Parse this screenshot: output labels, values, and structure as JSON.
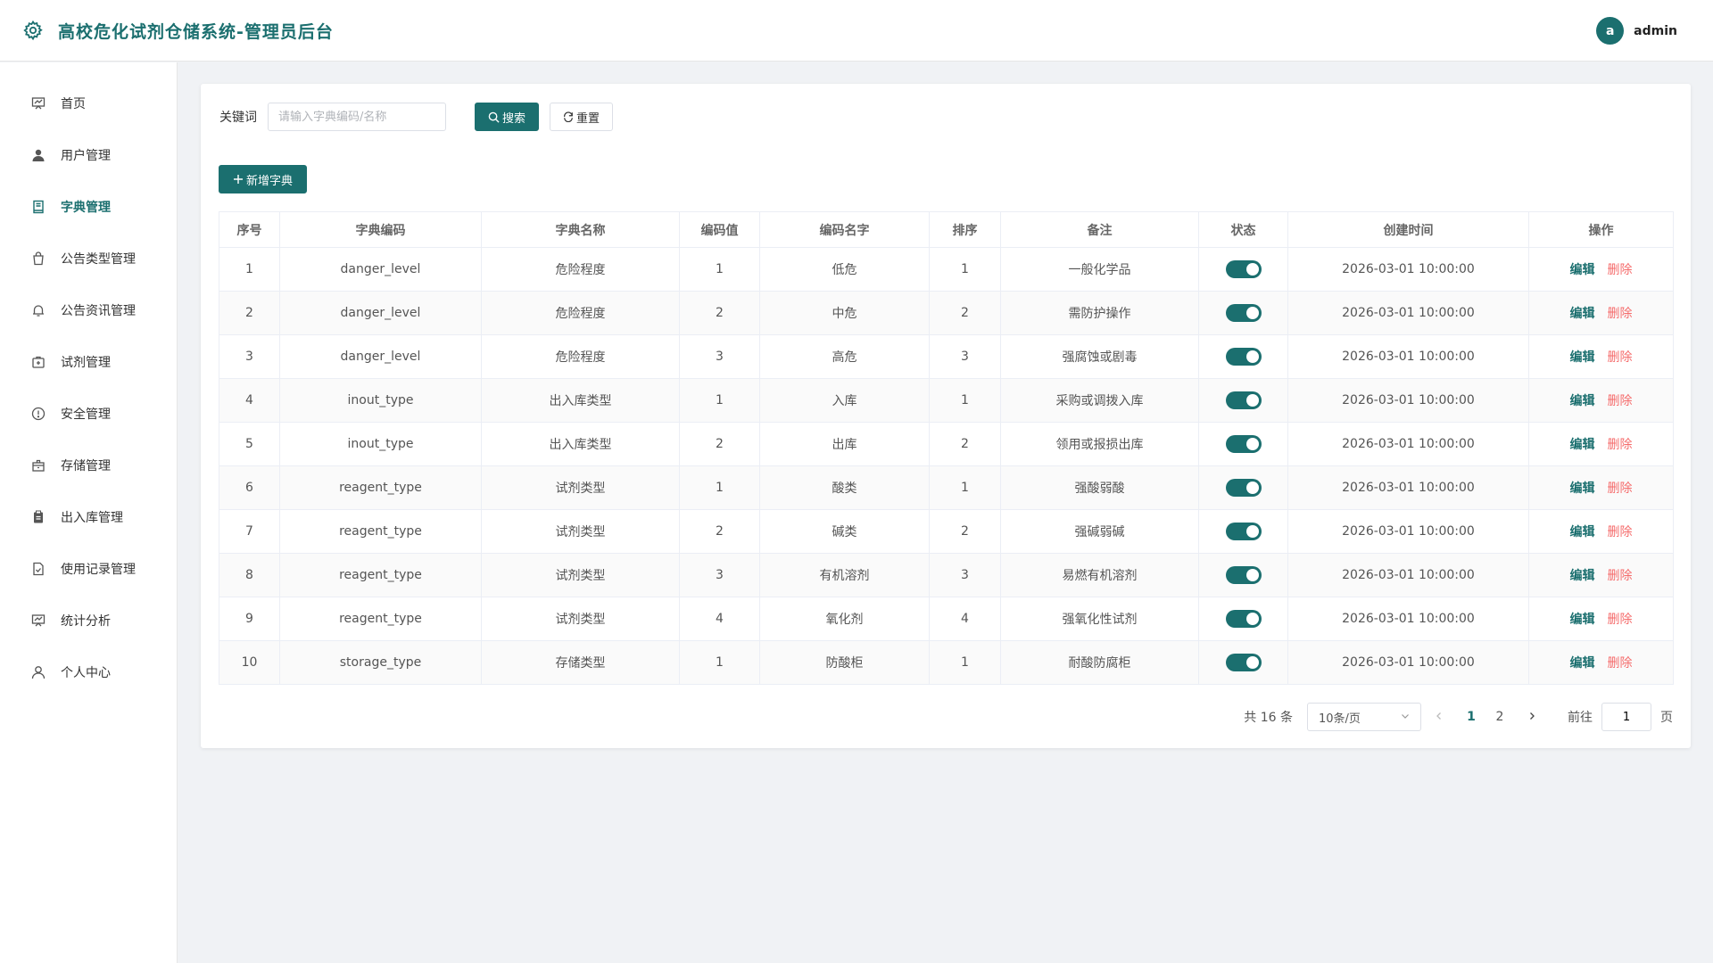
{
  "header": {
    "title": "高校危化试剂仓储系统-管理员后台",
    "avatar_letter": "a",
    "username": "admin"
  },
  "sidebar": {
    "items": [
      {
        "label": "首页",
        "icon": "dashboard-icon",
        "active": false
      },
      {
        "label": "用户管理",
        "icon": "user-icon",
        "active": false
      },
      {
        "label": "字典管理",
        "icon": "book-icon",
        "active": true
      },
      {
        "label": "公告类型管理",
        "icon": "bag-icon",
        "active": false
      },
      {
        "label": "公告资讯管理",
        "icon": "bell-icon",
        "active": false
      },
      {
        "label": "试剂管理",
        "icon": "medkit-icon",
        "active": false
      },
      {
        "label": "安全管理",
        "icon": "alert-icon",
        "active": false
      },
      {
        "label": "存储管理",
        "icon": "box-icon",
        "active": false
      },
      {
        "label": "出入库管理",
        "icon": "clipboard-icon",
        "active": false
      },
      {
        "label": "使用记录管理",
        "icon": "document-check-icon",
        "active": false
      },
      {
        "label": "统计分析",
        "icon": "chart-icon",
        "active": false
      },
      {
        "label": "个人中心",
        "icon": "person-icon",
        "active": false
      }
    ]
  },
  "search": {
    "label": "关键词",
    "placeholder": "请输入字典编码/名称",
    "search_button": "搜索",
    "reset_button": "重置"
  },
  "toolbar": {
    "add_button": "新增字典"
  },
  "table": {
    "columns": [
      "序号",
      "字典编码",
      "字典名称",
      "编码值",
      "编码名字",
      "排序",
      "备注",
      "状态",
      "创建时间",
      "操作"
    ],
    "edit_label": "编辑",
    "delete_label": "删除",
    "rows": [
      {
        "idx": "1",
        "code": "danger_level",
        "name": "危险程度",
        "value": "1",
        "value_name": "低危",
        "sort": "1",
        "remark": "一般化学品",
        "status": true,
        "created": "2026-03-01 10:00:00"
      },
      {
        "idx": "2",
        "code": "danger_level",
        "name": "危险程度",
        "value": "2",
        "value_name": "中危",
        "sort": "2",
        "remark": "需防护操作",
        "status": true,
        "created": "2026-03-01 10:00:00"
      },
      {
        "idx": "3",
        "code": "danger_level",
        "name": "危险程度",
        "value": "3",
        "value_name": "高危",
        "sort": "3",
        "remark": "强腐蚀或剧毒",
        "status": true,
        "created": "2026-03-01 10:00:00"
      },
      {
        "idx": "4",
        "code": "inout_type",
        "name": "出入库类型",
        "value": "1",
        "value_name": "入库",
        "sort": "1",
        "remark": "采购或调拨入库",
        "status": true,
        "created": "2026-03-01 10:00:00"
      },
      {
        "idx": "5",
        "code": "inout_type",
        "name": "出入库类型",
        "value": "2",
        "value_name": "出库",
        "sort": "2",
        "remark": "领用或报损出库",
        "status": true,
        "created": "2026-03-01 10:00:00"
      },
      {
        "idx": "6",
        "code": "reagent_type",
        "name": "试剂类型",
        "value": "1",
        "value_name": "酸类",
        "sort": "1",
        "remark": "强酸弱酸",
        "status": true,
        "created": "2026-03-01 10:00:00"
      },
      {
        "idx": "7",
        "code": "reagent_type",
        "name": "试剂类型",
        "value": "2",
        "value_name": "碱类",
        "sort": "2",
        "remark": "强碱弱碱",
        "status": true,
        "created": "2026-03-01 10:00:00"
      },
      {
        "idx": "8",
        "code": "reagent_type",
        "name": "试剂类型",
        "value": "3",
        "value_name": "有机溶剂",
        "sort": "3",
        "remark": "易燃有机溶剂",
        "status": true,
        "created": "2026-03-01 10:00:00"
      },
      {
        "idx": "9",
        "code": "reagent_type",
        "name": "试剂类型",
        "value": "4",
        "value_name": "氧化剂",
        "sort": "4",
        "remark": "强氧化性试剂",
        "status": true,
        "created": "2026-03-01 10:00:00"
      },
      {
        "idx": "10",
        "code": "storage_type",
        "name": "存储类型",
        "value": "1",
        "value_name": "防酸柜",
        "sort": "1",
        "remark": "耐酸防腐柜",
        "status": true,
        "created": "2026-03-01 10:00:00"
      }
    ]
  },
  "pagination": {
    "total_text": "共 16 条",
    "page_size": "10条/页",
    "pages": [
      "1",
      "2"
    ],
    "current_page": "1",
    "goto_label": "前往",
    "goto_value": "1",
    "goto_suffix": "页"
  },
  "colors": {
    "primary": "#1b6f6f",
    "danger": "#f56c6c"
  }
}
